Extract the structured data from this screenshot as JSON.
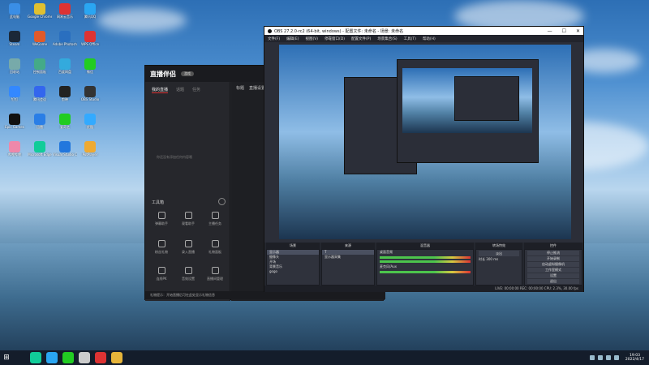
{
  "desktop": {
    "icons": [
      {
        "label": "此电脑",
        "color": "#3a8ee6"
      },
      {
        "label": "Google Chrome",
        "color": "#e0c030"
      },
      {
        "label": "网易云音乐",
        "color": "#d33"
      },
      {
        "label": "腾讯QQ",
        "color": "#2aa6f2"
      },
      {
        "label": "Steam",
        "color": "#1b2838"
      },
      {
        "label": "WeGame",
        "color": "#e05a2a"
      },
      {
        "label": "Adobe Photoshop",
        "color": "#2a6fbf"
      },
      {
        "label": "WPS Office",
        "color": "#d33"
      },
      {
        "label": "回收站",
        "color": "#7aa"
      },
      {
        "label": "控制面板",
        "color": "#4a8"
      },
      {
        "label": "百度网盘",
        "color": "#3ad"
      },
      {
        "label": "微信",
        "color": "#2c2"
      },
      {
        "label": "钉钉",
        "color": "#38f"
      },
      {
        "label": "腾讯会议",
        "color": "#36e"
      },
      {
        "label": "剪映",
        "color": "#222"
      },
      {
        "label": "OBS Studio",
        "color": "#333"
      },
      {
        "label": "Epic Games",
        "color": "#111"
      },
      {
        "label": "迅雷",
        "color": "#2a7ee6"
      },
      {
        "label": "爱奇艺",
        "color": "#2c2"
      },
      {
        "label": "优酷",
        "color": "#3af"
      },
      {
        "label": "哔哩哔哩",
        "color": "#e8a"
      },
      {
        "label": "Microsoft Edge",
        "color": "#1c9"
      },
      {
        "label": "Visual Studio Code",
        "color": "#27d"
      },
      {
        "label": "PotPlayer",
        "color": "#ea3"
      }
    ]
  },
  "zhibo": {
    "logo": "直播伴侣",
    "badge": "游戏",
    "tabs": [
      "我的直播",
      "话题",
      "任务"
    ],
    "empty_hint": "你还没有添加任何内容哦",
    "tools_title": "工具箱",
    "tools": [
      "弹幕助手",
      "观看助手",
      "主播任务",
      "粉丝礼物",
      "录入直播",
      "礼物面板",
      "连线PK",
      "音效设置",
      "直播间管理"
    ],
    "right_tabs": [
      "标题",
      "直播设置"
    ],
    "footer": "礼物提示：开始直播后可在此处显示礼物信息"
  },
  "obs": {
    "title": "OBS 27.2.0-rc2 (64-bit, windows) - 配置文件: 未命名 - 场景: 未命名",
    "menu": [
      "文件(F)",
      "编辑(E)",
      "视图(V)",
      "停靠窗口(D)",
      "配置文件(P)",
      "场景集合(S)",
      "工具(T)",
      "帮助(H)"
    ],
    "window_controls": [
      "—",
      "☐",
      "✕"
    ],
    "scenes_header": "场景",
    "scenes": [
      "显示器",
      "摄像头",
      "开场",
      "背景音乐",
      "gogo"
    ],
    "sources_header": "来源",
    "sources": [
      "T",
      "显示器采集"
    ],
    "mixer_header": "混音器",
    "mixer_tracks": [
      "桌面音频",
      "麦克风/Aux"
    ],
    "transition_header": "转场特效",
    "transition_value": "淡出",
    "duration_label": "时长",
    "duration_value": "300 ms",
    "controls_header": "控件",
    "controls": [
      "停止推流",
      "开始录制",
      "启动虚拟摄像机",
      "工作室模式",
      "设置",
      "退出"
    ],
    "status": "LIVE: 00:00:00   REC: 00:00:00   CPU: 2.3%, 30.00 fps"
  },
  "taskbar": {
    "start": "⊞",
    "apps": [
      {
        "name": "edge",
        "color": "#1c9"
      },
      {
        "name": "qq",
        "color": "#2aa6f2"
      },
      {
        "name": "wechat",
        "color": "#2c2"
      },
      {
        "name": "obs",
        "color": "#ccc"
      },
      {
        "name": "zhibo",
        "color": "#d33"
      },
      {
        "name": "explorer",
        "color": "#e6b43a"
      }
    ],
    "time": "19:03",
    "date": "2022/4/17"
  }
}
